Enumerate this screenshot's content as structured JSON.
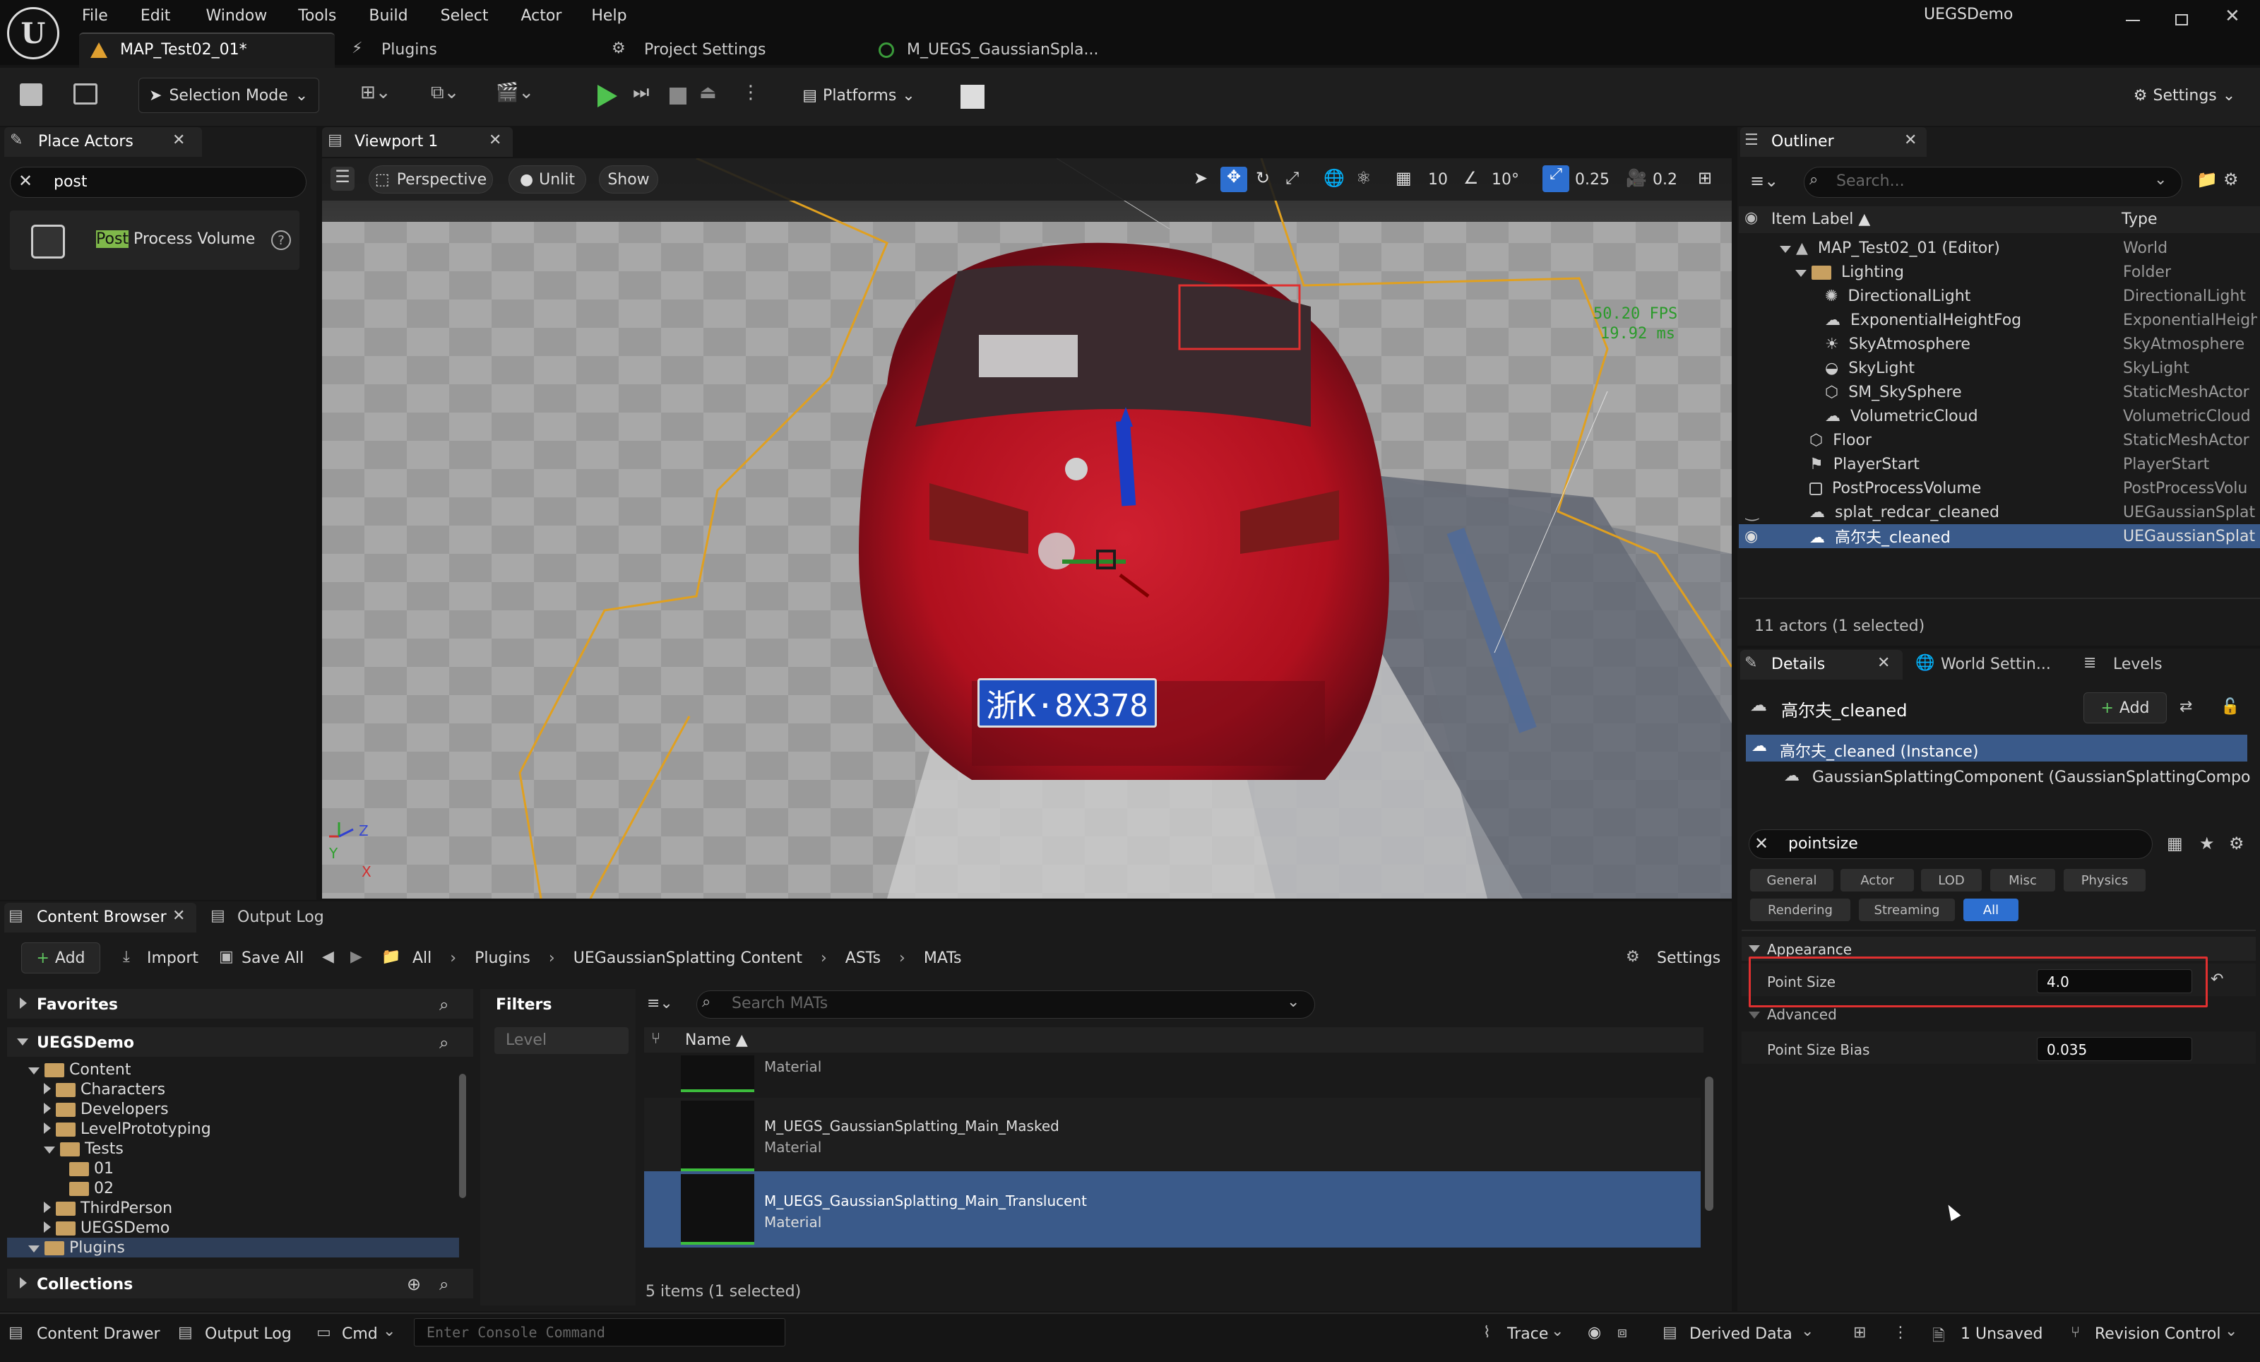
{
  "menu": [
    "File",
    "Edit",
    "Window",
    "Tools",
    "Build",
    "Select",
    "Actor",
    "Help"
  ],
  "window_title": "UEGSDemo",
  "doc_tabs": [
    {
      "label": "MAP_Test02_01*"
    },
    {
      "label": "Plugins"
    },
    {
      "label": "Project Settings"
    },
    {
      "label": "M_UEGS_GaussianSpla..."
    }
  ],
  "toolbar": {
    "selection_mode": "Selection Mode",
    "platforms": "Platforms",
    "settings": "Settings"
  },
  "place_actors": {
    "tab": "Place Actors",
    "search_value": "post",
    "result_highlight": "Post",
    "result_rest": " Process Volume"
  },
  "viewport": {
    "tab": "Viewport 1",
    "perspective": "Perspective",
    "unlit": "Unlit",
    "show": "Show",
    "grid": "10",
    "angle": "10°",
    "scale": "0.25",
    "camera": "0.2",
    "fps": "50.20 FPS",
    "ms": "19.92 ms",
    "plate": "浙K·8X378",
    "axis_z": "Z",
    "axis_y": "Y",
    "axis_x": "X"
  },
  "outliner": {
    "tab": "Outliner",
    "search_placeholder": "Search...",
    "col_label": "Item Label ▲",
    "col_type": "Type",
    "items": [
      {
        "name": "MAP_Test02_01 (Editor)",
        "type": "World"
      },
      {
        "name": "Lighting",
        "type": "Folder"
      },
      {
        "name": "DirectionalLight",
        "type": "DirectionalLight"
      },
      {
        "name": "ExponentialHeightFog",
        "type": "ExponentialHeigh"
      },
      {
        "name": "SkyAtmosphere",
        "type": "SkyAtmosphere"
      },
      {
        "name": "SkyLight",
        "type": "SkyLight"
      },
      {
        "name": "SM_SkySphere",
        "type": "StaticMeshActor"
      },
      {
        "name": "VolumetricCloud",
        "type": "VolumetricCloud"
      },
      {
        "name": "Floor",
        "type": "StaticMeshActor"
      },
      {
        "name": "PlayerStart",
        "type": "PlayerStart"
      },
      {
        "name": "PostProcessVolume",
        "type": "PostProcessVolu"
      },
      {
        "name": "splat_redcar_cleaned",
        "type": "UEGaussianSplat"
      },
      {
        "name": "高尔夫_cleaned",
        "type": "UEGaussianSplat"
      }
    ],
    "status": "11 actors (1 selected)"
  },
  "details": {
    "tabs": [
      "Details",
      "World Settin...",
      "Levels"
    ],
    "actor_name": "高尔夫_cleaned",
    "add": "Add",
    "instance": "高尔夫_cleaned (Instance)",
    "component": "GaussianSplattingComponent (GaussianSplattingCompone",
    "search_value": "pointsize",
    "filters": [
      "General",
      "Actor",
      "LOD",
      "Misc",
      "Physics",
      "Rendering",
      "Streaming",
      "All"
    ],
    "section": "Appearance",
    "point_size_label": "Point Size",
    "point_size_value": "4.0",
    "advanced": "Advanced",
    "bias_label": "Point Size Bias",
    "bias_value": "0.035"
  },
  "content_browser": {
    "tabs": [
      "Content Browser",
      "Output Log"
    ],
    "add": "Add",
    "import": "Import",
    "save_all": "Save All",
    "path": [
      "All",
      "Plugins",
      "UEGaussianSplatting Content",
      "ASTs",
      "MATs"
    ],
    "settings": "Settings",
    "favorites": "Favorites",
    "project": "UEGSDemo",
    "tree": [
      "Content",
      "Characters",
      "Developers",
      "LevelPrototyping",
      "Tests",
      "01",
      "02",
      "ThirdPerson",
      "UEGSDemo",
      "Plugins"
    ],
    "collections": "Collections",
    "filters": "Filters",
    "level_chip": "Level",
    "search_placeholder": "Search MATs",
    "col_name": "Name ▲",
    "items": [
      {
        "name": "",
        "type": "Material"
      },
      {
        "name": "M_UEGS_GaussianSplatting_Main_Masked",
        "type": "Material"
      },
      {
        "name": "M_UEGS_GaussianSplatting_Main_Translucent",
        "type": "Material"
      }
    ],
    "status": "5 items (1 selected)"
  },
  "statusbar": {
    "content_drawer": "Content Drawer",
    "output_log": "Output Log",
    "cmd": "Cmd",
    "console_placeholder": "Enter Console Command",
    "trace": "Trace",
    "derived": "Derived Data",
    "unsaved": "1 Unsaved",
    "revision": "Revision Control"
  }
}
